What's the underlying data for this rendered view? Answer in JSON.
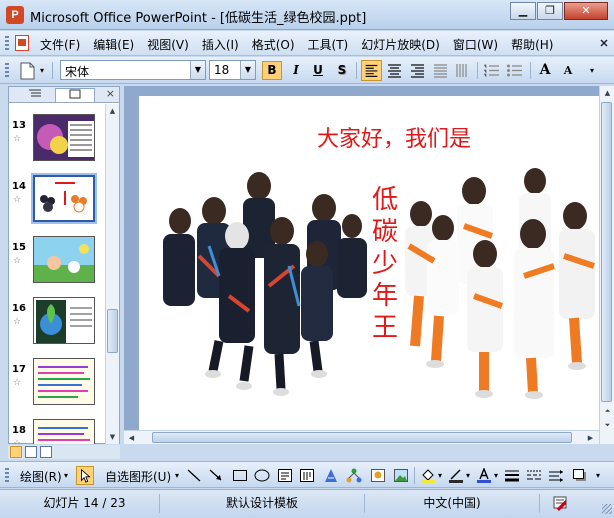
{
  "window": {
    "title": "Microsoft Office PowerPoint - [低碳生活_绿色校园.ppt]",
    "app_icon": "P"
  },
  "menu": [
    "文件(F)",
    "编辑(E)",
    "视图(V)",
    "插入(I)",
    "格式(O)",
    "工具(T)",
    "幻灯片放映(D)",
    "窗口(W)",
    "帮助(H)"
  ],
  "format_toolbar": {
    "font_name": "宋体",
    "font_size": "18",
    "bold": "B",
    "italic": "I",
    "underline": "U",
    "shadow": "S",
    "grow": "A",
    "shrink": "A"
  },
  "slides_pane": {
    "thumbnails": [
      {
        "number": "13",
        "selected": false
      },
      {
        "number": "14",
        "selected": true
      },
      {
        "number": "15",
        "selected": false
      },
      {
        "number": "16",
        "selected": false
      },
      {
        "number": "17",
        "selected": false
      },
      {
        "number": "18",
        "selected": false
      }
    ],
    "star": "☆"
  },
  "slide": {
    "title": "大家好，我们是",
    "vertical_text": "低碳少年王"
  },
  "drawing_toolbar": {
    "draw_label": "绘图(R)",
    "autoshapes_label": "自选图形(U)"
  },
  "status": {
    "slide_position": "幻灯片 14 / 23",
    "design": "默认设计模板",
    "language": "中文(中国)"
  },
  "colors": {
    "title_red": "#e21818",
    "accent_orange": "#ffd27a"
  }
}
